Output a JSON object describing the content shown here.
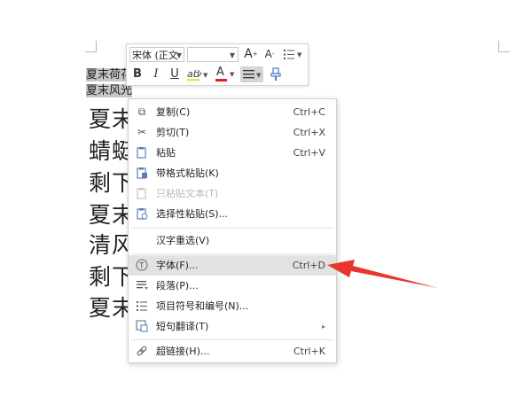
{
  "document": {
    "selected_lines": [
      "夏末荷花",
      "夏末风光"
    ],
    "body_lines": [
      "夏末",
      "蜻蜓",
      "剩下",
      "夏末",
      "清风",
      "剩下",
      "夏末"
    ]
  },
  "mini_toolbar": {
    "font_name": "宋体 (正文",
    "font_size": "",
    "grow_font": "A",
    "shrink_font": "A",
    "bold": "B",
    "italic": "I",
    "underline": "U",
    "font_color": "A"
  },
  "context_menu": {
    "items": [
      {
        "label": "复制(C)",
        "shortcut": "Ctrl+C",
        "icon": "copy-icon"
      },
      {
        "label": "剪切(T)",
        "shortcut": "Ctrl+X",
        "icon": "scissors-icon"
      },
      {
        "label": "粘贴",
        "shortcut": "Ctrl+V",
        "icon": "paste-icon"
      },
      {
        "label": "带格式粘贴(K)",
        "shortcut": "",
        "icon": "paste-format-icon"
      },
      {
        "label": "只粘贴文本(T)",
        "shortcut": "",
        "icon": "paste-text-icon"
      },
      {
        "label": "选择性粘贴(S)...",
        "shortcut": "",
        "icon": "paste-special-icon"
      },
      {
        "label": "汉字重选(V)",
        "shortcut": "",
        "icon": ""
      },
      {
        "label": "字体(F)...",
        "shortcut": "Ctrl+D",
        "icon": "font-icon"
      },
      {
        "label": "段落(P)...",
        "shortcut": "",
        "icon": "paragraph-icon"
      },
      {
        "label": "项目符号和编号(N)...",
        "shortcut": "",
        "icon": "list-icon"
      },
      {
        "label": "短句翻译(T)",
        "shortcut": "",
        "icon": "translate-icon"
      },
      {
        "label": "超链接(H)...",
        "shortcut": "Ctrl+K",
        "icon": "link-icon"
      }
    ]
  },
  "colors": {
    "arrow": "#e8362f",
    "font_color_bar": "#e02020",
    "highlight": "#e2e2e2"
  }
}
